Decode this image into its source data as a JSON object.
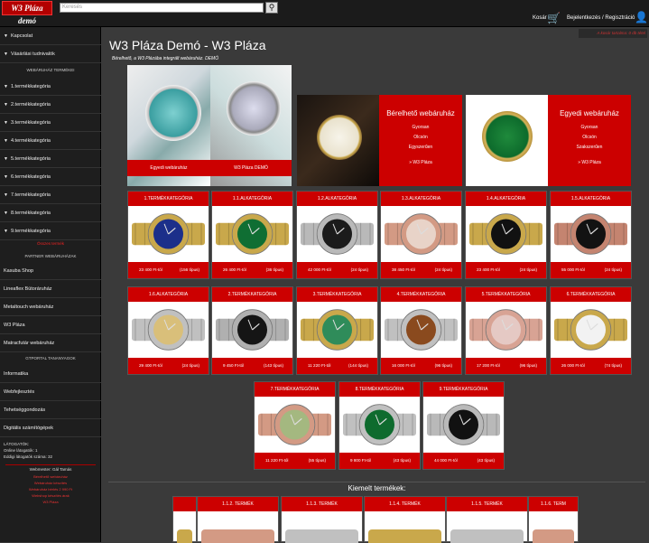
{
  "header": {
    "logo": "W3 Pláza demó",
    "search_placeholder": "Keresés",
    "cart": "Kosár",
    "login": "Bejelentkezés / Regisztráció",
    "notice": "A kosár tartalma: 0 db tétel"
  },
  "sidebar": {
    "top_items": [
      "Kapcsolat",
      "Vásárlási tudnivalók"
    ],
    "webshop_head": "WEBÁRUHÁZ TERMÉKEI",
    "categories": [
      "1.termékkategória",
      "2.termékkategória",
      "3.termékkategória",
      "4.termékkategória",
      "5.termékkategória",
      "6.termékkategória",
      "7.termékkategória",
      "8.termékkategória",
      "9.termékkategória"
    ],
    "all_link": "Összes termék",
    "partner_head": "PARTNER WEBÁRUHÁZAK",
    "partners": [
      "Kasuba Shop",
      "Lineaflex Bútoráruház",
      "Metaltouch webáruház",
      "W3 Pláza",
      "Matracfutár webáruház"
    ],
    "gt_head": "GTPORTAL TANANYAGOK",
    "gt_items": [
      "Informatika",
      "Webfejlesztés",
      "Tehetséggondozás",
      "Digitális számítógépek"
    ],
    "visitors_label": "LÁTOGATÓK:",
    "online": "Online látogatók: 1",
    "total": "Eddigi látogatók száma: 32",
    "webmaster": "Webmester: Gál Tamás",
    "footer_links": [
      "Bérelhető webáruház",
      "Webáruház készítés",
      "Webáruház bérlés 2 990 Ft",
      "Webshop készítés árak",
      "W3 Pláza"
    ]
  },
  "main": {
    "title": "W3 Pláza Demó - W3 Pláza",
    "subtitle": "Bérelhető, a W3 Plázába integrált webáruház. DEMÓ",
    "cube_labels": [
      "Egyedi webáruház",
      "W3 Pláza DEMÓ"
    ],
    "promo1": {
      "title": "Bérelhető webáruház",
      "lines": [
        "Gyorsan",
        "Olcsón",
        "Egyszerűen"
      ],
      "cta": "» W3 Pláza"
    },
    "promo2": {
      "title": "Egyedi webáruház",
      "lines": [
        "Gyorsan",
        "Olcsón",
        "Szakszerűen"
      ],
      "cta": "» W3 Pláza"
    }
  },
  "cards": [
    {
      "title": "1.TERMÉKKATEGÓRIA",
      "price": "23 400 Ft-tól",
      "count": "(156 típus)",
      "dial": "#1c2f8a",
      "metal": "#c9a84b"
    },
    {
      "title": "1.1.ALKATEGÓRIA",
      "price": "26 400 Ft-tól",
      "count": "(36 típus)",
      "dial": "#0f6e33",
      "metal": "#c9a84b"
    },
    {
      "title": "1.2.ALKATEGÓRIA",
      "price": "42 000 Ft-tól",
      "count": "(24 típus)",
      "dial": "#1b1b1b",
      "metal": "#b9b9b9"
    },
    {
      "title": "1.3.ALKATEGÓRIA",
      "price": "38 450 Ft-tól",
      "count": "(24 típus)",
      "dial": "#e8d3c8",
      "metal": "#d39a84"
    },
    {
      "title": "1.4.ALKATEGÓRIA",
      "price": "23 400 Ft-tól",
      "count": "(24 típus)",
      "dial": "#111111",
      "metal": "#c9a84b"
    },
    {
      "title": "1.5.ALKATEGÓRIA",
      "price": "55 000 Ft-tól",
      "count": "(24 típus)",
      "dial": "#121212",
      "metal": "#c48470"
    },
    {
      "title": "1.6.ALKATEGÓRIA",
      "price": "29 400 Ft-tól",
      "count": "(24 típus)",
      "dial": "#d9bf7a",
      "metal": "#c0c0c0"
    },
    {
      "title": "2.TERMÉKKATEGÓRIA",
      "price": "9 450 Ft-tól",
      "count": "(143 típus)",
      "dial": "#151515",
      "metal": "#b0b0b0"
    },
    {
      "title": "3.TERMÉKKATEGÓRIA",
      "price": "11 220 Ft-tól",
      "count": "(144 típus)",
      "dial": "#2f8c5a",
      "metal": "#c9a84b"
    },
    {
      "title": "4.TERMÉKKATEGÓRIA",
      "price": "16 000 Ft-tól",
      "count": "(96 típus)",
      "dial": "#8a4a1e",
      "metal": "#c0c0c0"
    },
    {
      "title": "5.TERMÉKKATEGÓRIA",
      "price": "17 200 Ft-tól",
      "count": "(96 típus)",
      "dial": "#e5c9c4",
      "metal": "#d8a394"
    },
    {
      "title": "6.TERMÉKKATEGÓRIA",
      "price": "26 000 Ft-tól",
      "count": "(74 típus)",
      "dial": "#f2f2f2",
      "metal": "#c9a84b"
    },
    {
      "title": "7.TERMÉKKATEGÓRIA",
      "price": "11 220 Ft-tól",
      "count": "(55 típus)",
      "dial": "#a4b880",
      "metal": "#d39a84"
    },
    {
      "title": "8.TERMÉKKATEGÓRIA",
      "price": "9 800 Ft-tól",
      "count": "(43 típus)",
      "dial": "#0e6b2e",
      "metal": "#c0c0c0"
    },
    {
      "title": "9.TERMÉKKATEGÓRIA",
      "price": "44 000 Ft-tól",
      "count": "(43 típus)",
      "dial": "#111111",
      "metal": "#b9b9b9"
    }
  ],
  "featured": {
    "title": "Kiemelt termékek:",
    "items": [
      {
        "title": "",
        "metal": "#c9a84b"
      },
      {
        "title": "1.1.2. TERMÉK",
        "metal": "#d39a84"
      },
      {
        "title": "1.1.3. TERMÉK",
        "metal": "#c0c0c0"
      },
      {
        "title": "1.1.4. TERMÉK",
        "metal": "#c9a84b"
      },
      {
        "title": "1.1.5. TERMÉK",
        "metal": "#c0c0c0"
      },
      {
        "title": "1.1.6. TERM",
        "metal": "#d39a84"
      }
    ]
  }
}
